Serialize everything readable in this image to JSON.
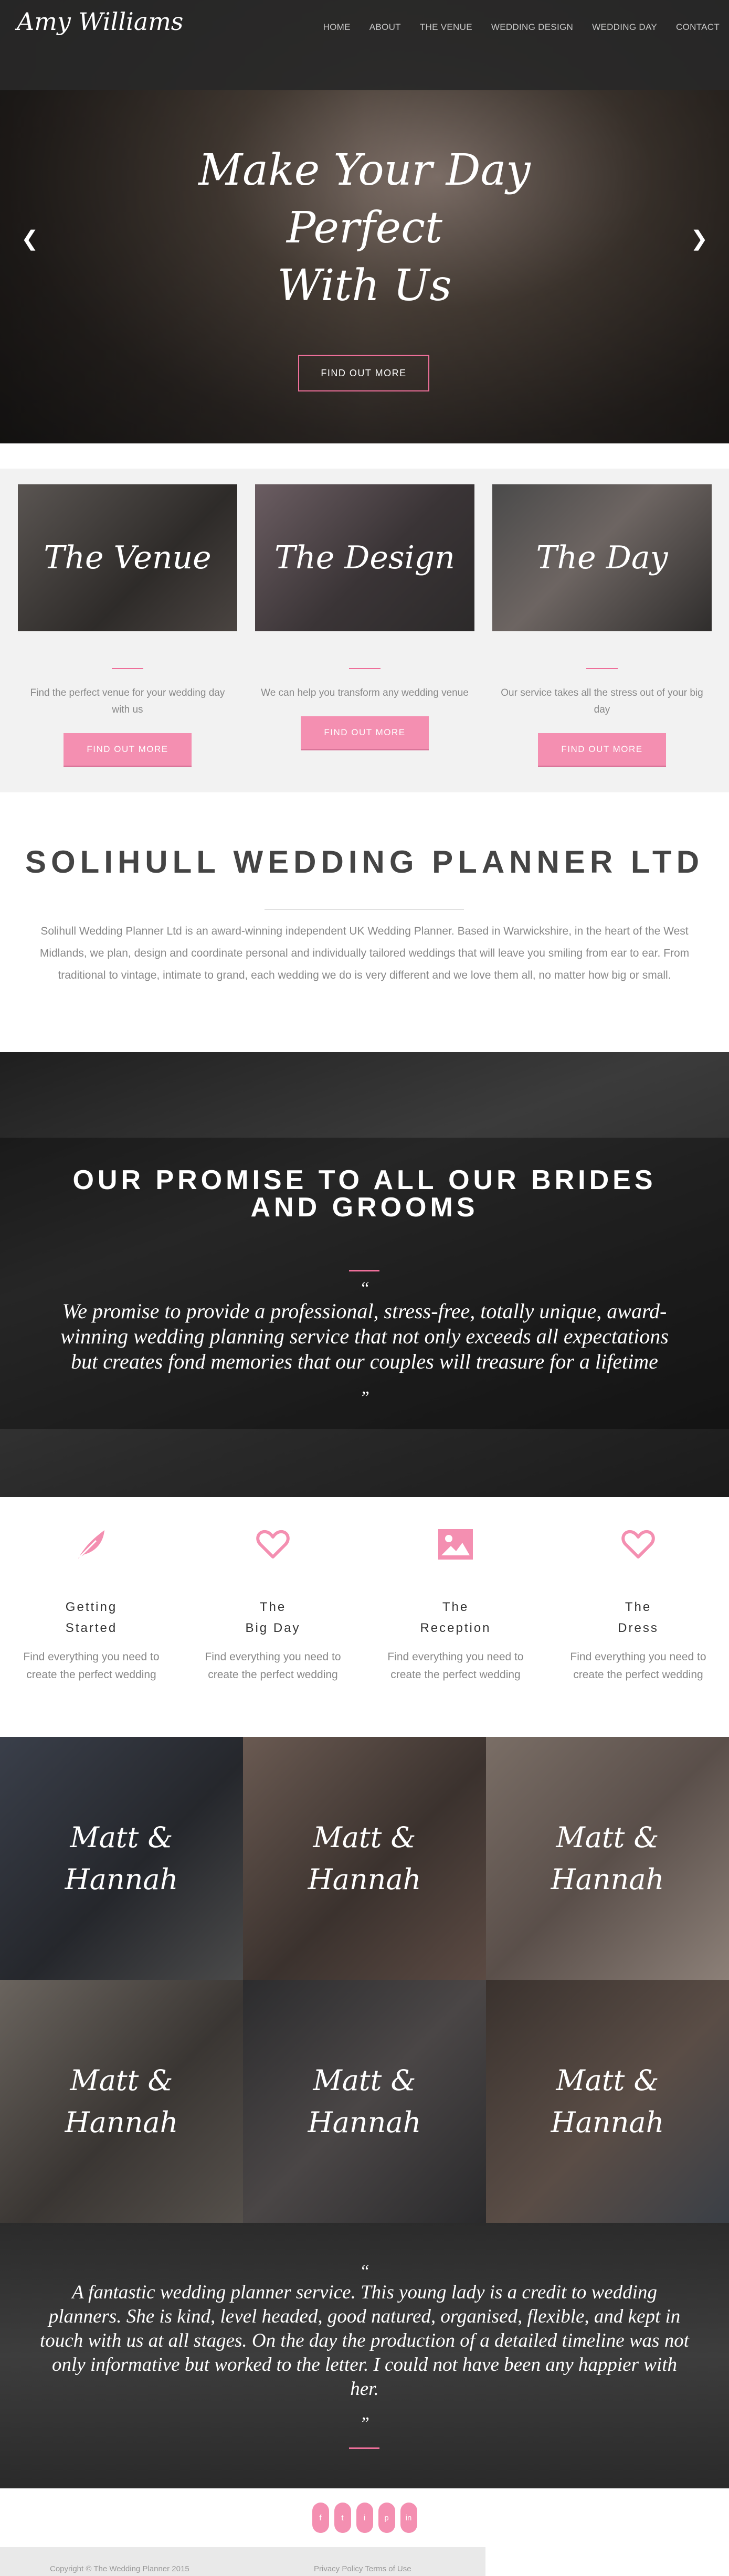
{
  "header": {
    "logo": "Amy Williams",
    "nav": [
      "HOME",
      "ABOUT",
      "THE VENUE",
      "WEDDING DESIGN",
      "WEDDING DAY",
      "CONTACT"
    ]
  },
  "hero": {
    "title_lines": [
      "Make Your Day",
      "Perfect",
      "With Us"
    ],
    "button": "FIND OUT MORE",
    "prev_icon": "chevron-left-icon",
    "next_icon": "chevron-right-icon"
  },
  "features": [
    {
      "title": "The Venue",
      "text": "Find the perfect venue for your wedding day with us",
      "button": "FIND OUT MORE"
    },
    {
      "title": "The Design",
      "text": "We can help you transform any wedding venue",
      "button": "FIND OUT MORE"
    },
    {
      "title": "The Day",
      "text": "Our service takes all the stress out of your big day",
      "button": "FIND OUT MORE"
    }
  ],
  "about": {
    "heading": "SOLIHULL WEDDING PLANNER LTD",
    "text": "Solihull Wedding Planner Ltd is an award-winning independent UK Wedding Planner. Based in Warwickshire, in the heart of the West Midlands, we plan, design and coordinate personal and individually tailored weddings that will leave you smiling from ear to ear. From traditional to vintage, intimate to grand, each wedding we do is very different and we love them all, no matter how big or small."
  },
  "promise": {
    "heading_line1": "OUR PROMISE TO ALL OUR BRIDES",
    "heading_line2": "AND GROOMS",
    "open_quote": "“",
    "close_quote": "”",
    "text": "We promise to provide a professional, stress-free, totally unique, award-winning wedding planning service that not only exceeds all expectations but creates fond memories that our couples will treasure for a lifetime"
  },
  "services": [
    {
      "icon": "feather-icon",
      "title_l1": "Getting",
      "title_l2": "Started",
      "text": "Find everything you need to create the perfect wedding"
    },
    {
      "icon": "heart-icon",
      "title_l1": "The",
      "title_l2": "Big Day",
      "text": "Find everything you need to create the perfect wedding"
    },
    {
      "icon": "image-icon",
      "title_l1": "The",
      "title_l2": "Reception",
      "text": "Find everything you need to create the perfect wedding"
    },
    {
      "icon": "heart-icon",
      "title_l1": "The",
      "title_l2": "Dress",
      "text": "Find everything you need to create the perfect wedding"
    }
  ],
  "gallery": [
    {
      "l1": "Matt &",
      "l2": "Hannah"
    },
    {
      "l1": "Matt &",
      "l2": "Hannah"
    },
    {
      "l1": "Matt &",
      "l2": "Hannah"
    },
    {
      "l1": "Matt &",
      "l2": "Hannah"
    },
    {
      "l1": "Matt &",
      "l2": "Hannah"
    },
    {
      "l1": "Matt &",
      "l2": "Hannah"
    }
  ],
  "testimonial": {
    "open_quote": "“",
    "close_quote": "”",
    "text": "A fantastic wedding planner service. This young lady is a credit to wedding planners. She is kind, level headed, good natured, organised, flexible, and kept in touch with us at all stages. On the day the production of a detailed timeline was not only informative but worked to the letter. I could not have been any happier with her."
  },
  "social": [
    {
      "icon": "facebook-icon",
      "glyph": "f"
    },
    {
      "icon": "twitter-icon",
      "glyph": "t"
    },
    {
      "icon": "instagram-icon",
      "glyph": "i"
    },
    {
      "icon": "pinterest-icon",
      "glyph": "p"
    },
    {
      "icon": "linkedin-icon",
      "glyph": "in"
    }
  ],
  "footer": {
    "copyright": "Copyright © The Wedding Planner 2015",
    "links": "Privacy Policy Terms of Use"
  },
  "colors": {
    "accent": "#ee6f9a",
    "button_pink": "#f48fb1",
    "dark_overlay": "#282828"
  }
}
